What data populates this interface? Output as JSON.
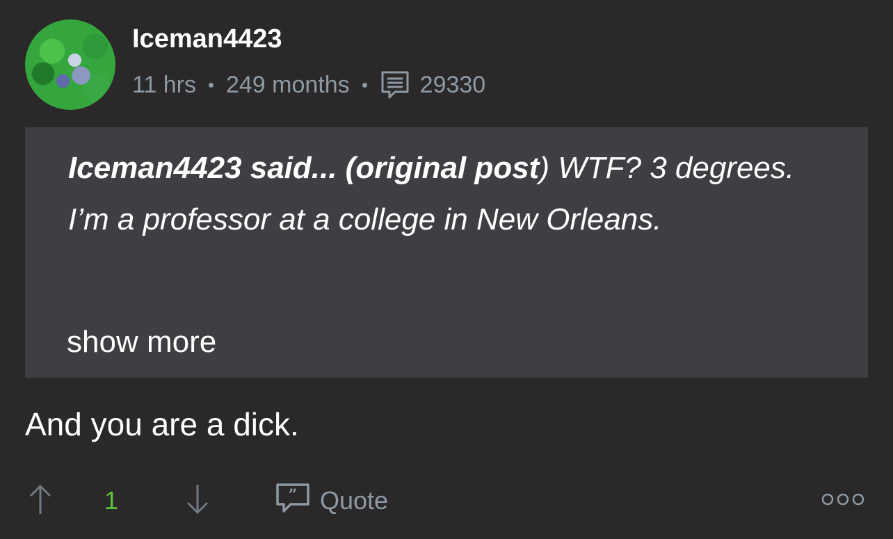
{
  "post": {
    "username": "Iceman4423",
    "time_ago": "11 hrs",
    "member_for": "249 months",
    "post_count": "29330"
  },
  "quote": {
    "author_line": "Iceman4423 said... (original post",
    "close_paren": ")",
    "text": " WTF? 3 degrees. I’m a professor at a college in New Orleans.",
    "show_more_label": "show more"
  },
  "comment": {
    "text": "And you are a dick."
  },
  "actions": {
    "vote_count": "1",
    "quote_label": "Quote"
  },
  "colors": {
    "background": "#2a2828",
    "quote_background": "#3e3f42",
    "meta_text": "#8d9aa5",
    "vote_green": "#5ec43b"
  },
  "icons": {
    "posts": "posts-icon",
    "upvote": "arrow-up-icon",
    "downvote": "arrow-down-icon",
    "quote": "quote-icon",
    "more": "more-options-icon"
  }
}
